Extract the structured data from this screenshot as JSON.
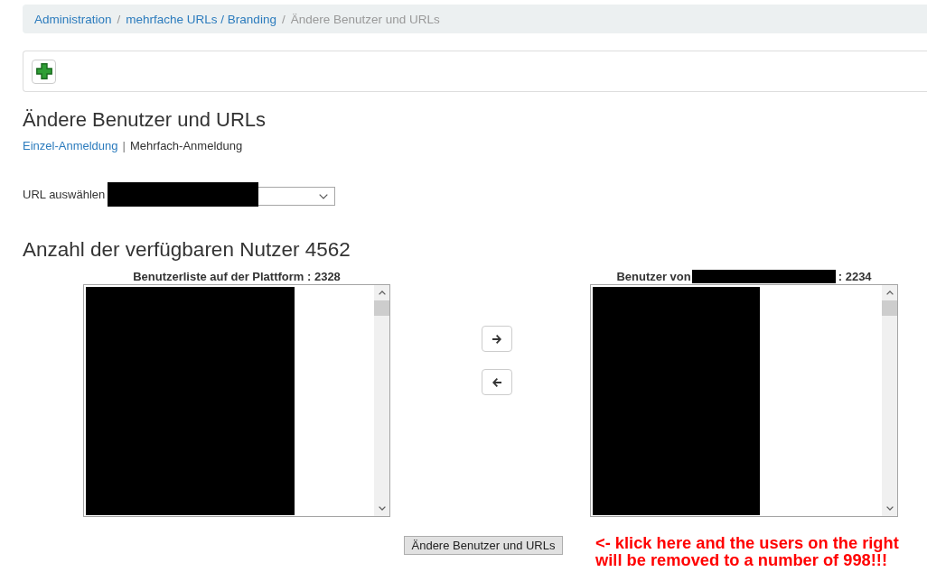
{
  "breadcrumb": {
    "separator": "/",
    "items": [
      {
        "label": "Administration",
        "current": false
      },
      {
        "label": "mehrfache URLs / Branding",
        "current": false
      },
      {
        "label": "Ändere Benutzer und URLs",
        "current": true
      }
    ]
  },
  "toolbar": {
    "add_button": true
  },
  "title": "Ändere Benutzer und URLs",
  "login_modes": {
    "separator": "|",
    "items": [
      {
        "label": "Einzel-Anmeldung",
        "selected": false
      },
      {
        "label": "Mehrfach-Anmeldung",
        "selected": true
      }
    ]
  },
  "url_select": {
    "label": "URL auswählen",
    "redacted": true
  },
  "available_users": "Anzahl der verfügbaren Nutzer 4562",
  "lists": [
    {
      "title": [
        {
          "kind": "text",
          "text": "Benutzerliste auf der Plattform : 2328"
        }
      ],
      "redacted": true
    },
    {
      "title": [
        {
          "kind": "text",
          "text": "Benutzer von"
        },
        {
          "kind": "redaction"
        },
        {
          "kind": "text",
          "text": ": 2234"
        }
      ],
      "redacted": true
    }
  ],
  "move_buttons": [
    {
      "kind": "right"
    },
    {
      "kind": "left"
    }
  ],
  "submit_button": "Ändere Benutzer und URLs",
  "annotation": {
    "lines": [
      "<- klick here and the users on the right",
      "will be removed to a number of 998!!!"
    ]
  }
}
